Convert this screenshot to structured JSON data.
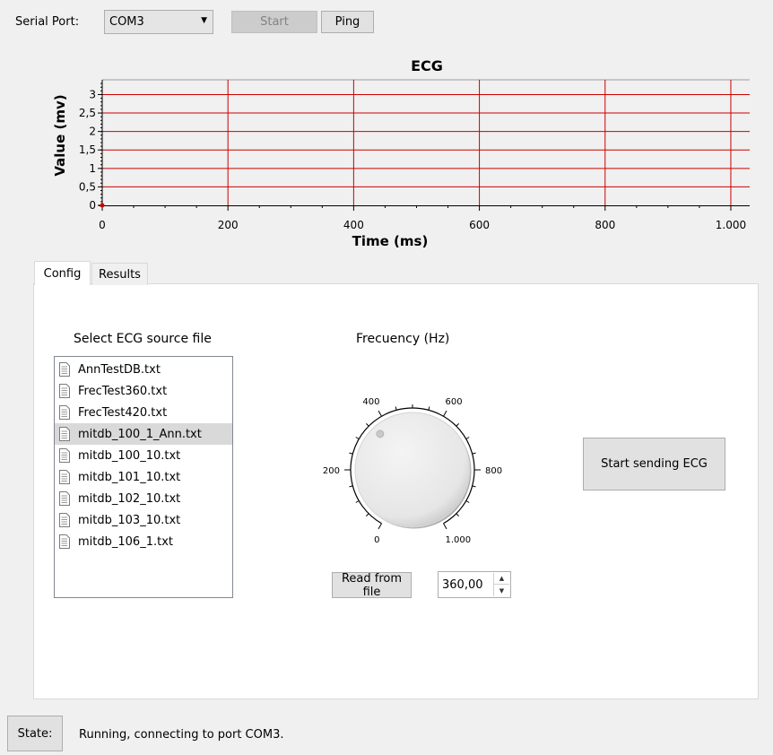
{
  "toolbar": {
    "serial_port_label": "Serial Port:",
    "port_value": "COM3",
    "start_label": "Start",
    "ping_label": "Ping"
  },
  "chart_data": {
    "type": "line",
    "title": "ECG",
    "xlabel": "Time (ms)",
    "ylabel": "Value (mv)",
    "xlim": [
      0,
      1030
    ],
    "ylim": [
      0,
      3.4
    ],
    "x_ticks": [
      0,
      200,
      400,
      600,
      800,
      1000
    ],
    "x_tick_labels": [
      "0",
      "200",
      "400",
      "600",
      "800",
      "1.000"
    ],
    "y_ticks": [
      0,
      0.5,
      1,
      1.5,
      2,
      2.5,
      3
    ],
    "y_tick_labels": [
      "0",
      "0,5",
      "1",
      "1,5",
      "2",
      "2,5",
      "3"
    ],
    "grid": true,
    "series": [
      {
        "x": [
          0
        ],
        "y": [
          0
        ]
      }
    ],
    "colors": {
      "grid": "#cc0000",
      "point": "#cc0000",
      "background": "#f0f0f0"
    }
  },
  "tabs": [
    {
      "label": "Config",
      "active": true
    },
    {
      "label": "Results",
      "active": false
    }
  ],
  "config": {
    "source_title": "Select ECG source file",
    "files": [
      "AnnTestDB.txt",
      "FrecTest360.txt",
      "FrecTest420.txt",
      "mitdb_100_1_Ann.txt",
      "mitdb_100_10.txt",
      "mitdb_101_10.txt",
      "mitdb_102_10.txt",
      "mitdb_103_10.txt",
      "mitdb_106_1.txt"
    ],
    "selected_file_index": 3,
    "frequency_title": "Frecuency (Hz)",
    "dial_labels": [
      "0",
      "200",
      "400",
      "600",
      "800",
      "1.000"
    ],
    "dial_value": 360,
    "read_from_file_label": "Read from file",
    "frequency_value": "360,00",
    "start_sending_label": "Start sending ECG"
  },
  "status": {
    "state_label": "State:",
    "message": "Running, connecting to port COM3."
  }
}
